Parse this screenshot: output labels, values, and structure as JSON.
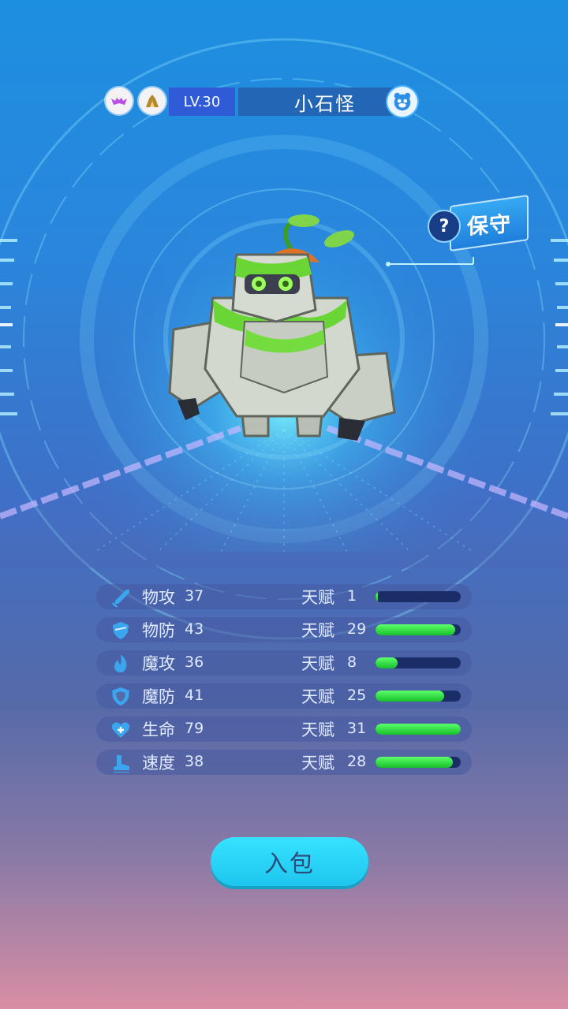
{
  "header": {
    "badges": [
      {
        "icon": "bat-wing-icon",
        "color": "#b84ee6"
      },
      {
        "icon": "rock-element-icon",
        "color": "#b58a2c"
      }
    ],
    "level_label": "LV.30",
    "name": "小石怪",
    "pet_icon": "pet-face-icon"
  },
  "trait": {
    "help": "?",
    "label": "保守"
  },
  "monster": {
    "icon": "stone-golem-figure"
  },
  "stats": [
    {
      "icon": "sword-icon",
      "label": "物攻",
      "value": "37",
      "talent_label": "天赋",
      "talent": "1",
      "talent_max": 31
    },
    {
      "icon": "shield-icon",
      "label": "物防",
      "value": "43",
      "talent_label": "天赋",
      "talent": "29",
      "talent_max": 31
    },
    {
      "icon": "flame-icon",
      "label": "魔攻",
      "value": "36",
      "talent_label": "天赋",
      "talent": "8",
      "talent_max": 31
    },
    {
      "icon": "magic-shield-icon",
      "label": "魔防",
      "value": "41",
      "talent_label": "天赋",
      "talent": "25",
      "talent_max": 31
    },
    {
      "icon": "heart-plus-icon",
      "label": "生命",
      "value": "79",
      "talent_label": "天赋",
      "talent": "31",
      "talent_max": 31
    },
    {
      "icon": "boot-icon",
      "label": "速度",
      "value": "38",
      "talent_label": "天赋",
      "talent": "28",
      "talent_max": 31
    }
  ],
  "actions": {
    "bag_label": "入包"
  },
  "colors": {
    "accent": "#28d4f5",
    "bar_fill": "#2ee03d",
    "bar_track": "#1b2d66"
  }
}
